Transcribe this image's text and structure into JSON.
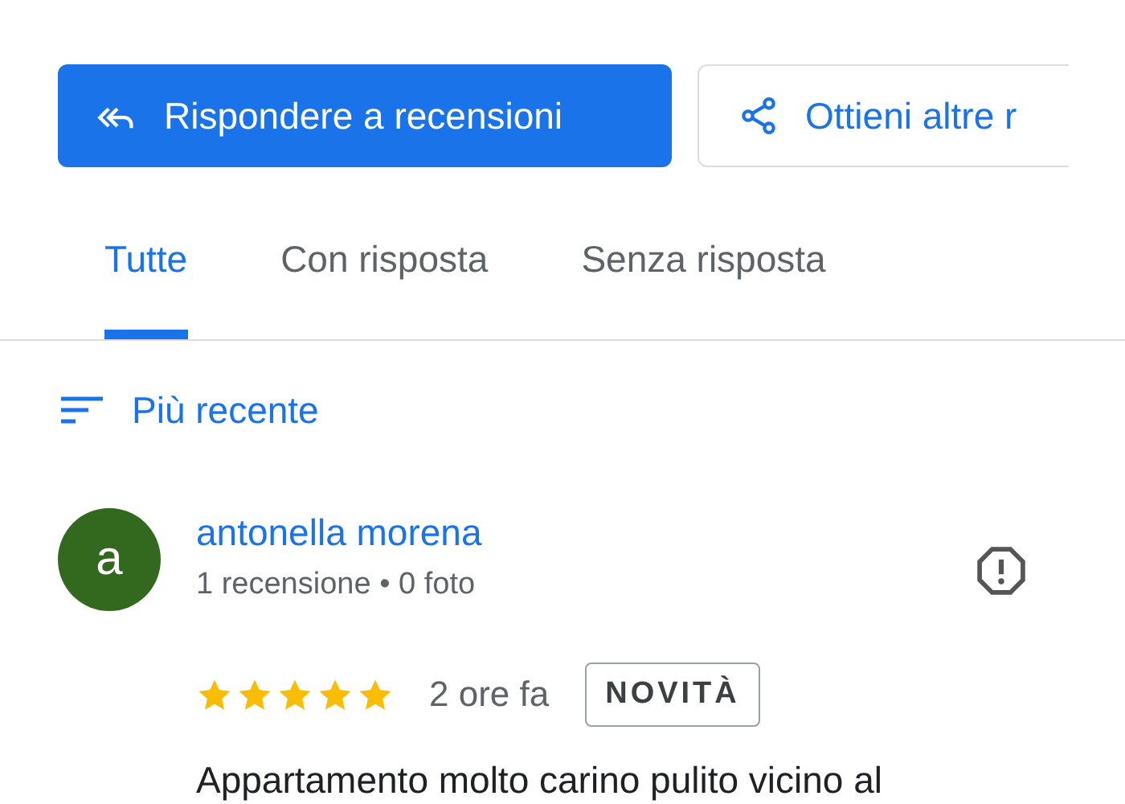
{
  "actions": [
    {
      "kind": "primary",
      "label": "Rispondere a recensioni"
    },
    {
      "kind": "outline",
      "label": "Ottieni altre r"
    }
  ],
  "tabs": [
    {
      "label": "Tutte",
      "selected": true
    },
    {
      "label": "Con risposta",
      "selected": false
    },
    {
      "label": "Senza risposta",
      "selected": false
    }
  ],
  "sort": {
    "label": "Più recente"
  },
  "review": {
    "avatar_letter": "a",
    "name": "antonella morena",
    "meta": "1 recensione • 0 foto",
    "stars": 5,
    "time": "2 ore fa",
    "badge": "NOVITÀ",
    "text": "Appartamento molto carino pulito vicino al"
  }
}
